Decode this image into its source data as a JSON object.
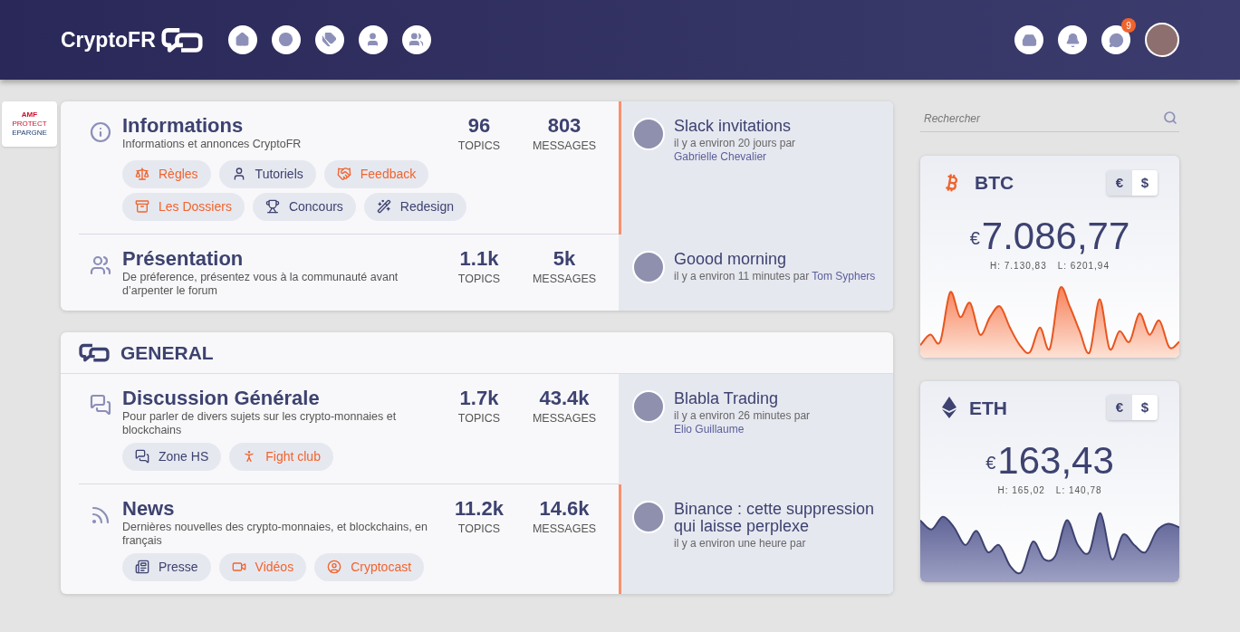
{
  "header": {
    "brand": "CryptoFR",
    "notification_count": "9"
  },
  "ad": {
    "lines": [
      "AMF",
      "PROTECT",
      "EPARGNE"
    ]
  },
  "categories": [
    {
      "forums": [
        {
          "name": "Informations",
          "description": "Informations et annonces CryptoFR",
          "topics": "96",
          "topics_label": "TOPICS",
          "messages": "803",
          "messages_label": "MESSAGES",
          "highlighted": true,
          "tags": [
            {
              "label": "Règles",
              "color": "#f0642d"
            },
            {
              "label": "Tutoriels",
              "color": "#3d4270"
            },
            {
              "label": "Feedback",
              "color": "#f0642d"
            },
            {
              "label": "Les Dossiers",
              "color": "#f0642d"
            },
            {
              "label": "Concours",
              "color": "#3d4270"
            },
            {
              "label": "Redesign",
              "color": "#3d4270"
            }
          ],
          "last_post": {
            "title": "Slack invitations",
            "meta": "il y a environ 20 jours par",
            "author": "Gabrielle Chevalier"
          }
        },
        {
          "name": "Présentation",
          "description": "De préference, présentez vous à la communauté avant d’arpenter le forum",
          "topics": "1.1k",
          "topics_label": "TOPICS",
          "messages": "5k",
          "messages_label": "MESSAGES",
          "highlighted": false,
          "last_post": {
            "title": "Goood morning",
            "meta": "il y a environ 11 minutes par",
            "author": "Tom Syphers"
          }
        }
      ]
    },
    {
      "title": "GENERAL",
      "forums": [
        {
          "name": "Discussion Générale",
          "description": "Pour parler de divers sujets sur les crypto-monnaies et blockchains",
          "topics": "1.7k",
          "topics_label": "TOPICS",
          "messages": "43.4k",
          "messages_label": "MESSAGES",
          "highlighted": false,
          "tags": [
            {
              "label": "Zone HS",
              "color": "#3d4270"
            },
            {
              "label": "Fight club",
              "color": "#f0642d"
            }
          ],
          "last_post": {
            "title": "Blabla Trading",
            "meta": "il y a environ 26 minutes par",
            "author": "Elio Guillaume"
          }
        },
        {
          "name": "News",
          "description": "Dernières nouvelles des crypto-monnaies, et blockchains, en français",
          "topics": "11.2k",
          "topics_label": "TOPICS",
          "messages": "14.6k",
          "messages_label": "MESSAGES",
          "highlighted": true,
          "tags": [
            {
              "label": "Presse",
              "color": "#3d4270"
            },
            {
              "label": "Vidéos",
              "color": "#f0642d"
            },
            {
              "label": "Cryptocast",
              "color": "#f0642d"
            }
          ],
          "last_post": {
            "title": "Binance : cette suppression qui laisse perplexe",
            "meta": "il y a environ une heure par"
          }
        }
      ]
    }
  ],
  "sidebar": {
    "search": {
      "placeholder": "Rechercher"
    },
    "tickers": [
      {
        "kind": "btc",
        "symbol": "BTC",
        "currency_sign": "€",
        "price": "7.086,77",
        "high": "H: 7.130,83",
        "low": "L: 6201,94",
        "currencies": [
          {
            "label": "€",
            "selected": true
          },
          {
            "label": "$",
            "selected": false
          }
        ]
      },
      {
        "kind": "eth",
        "symbol": "ETH",
        "currency_sign": "€",
        "price": "163,43",
        "high": "H: 165,02",
        "low": "L: 140,78",
        "currencies": [
          {
            "label": "€",
            "selected": true
          },
          {
            "label": "$",
            "selected": false
          }
        ]
      }
    ]
  }
}
